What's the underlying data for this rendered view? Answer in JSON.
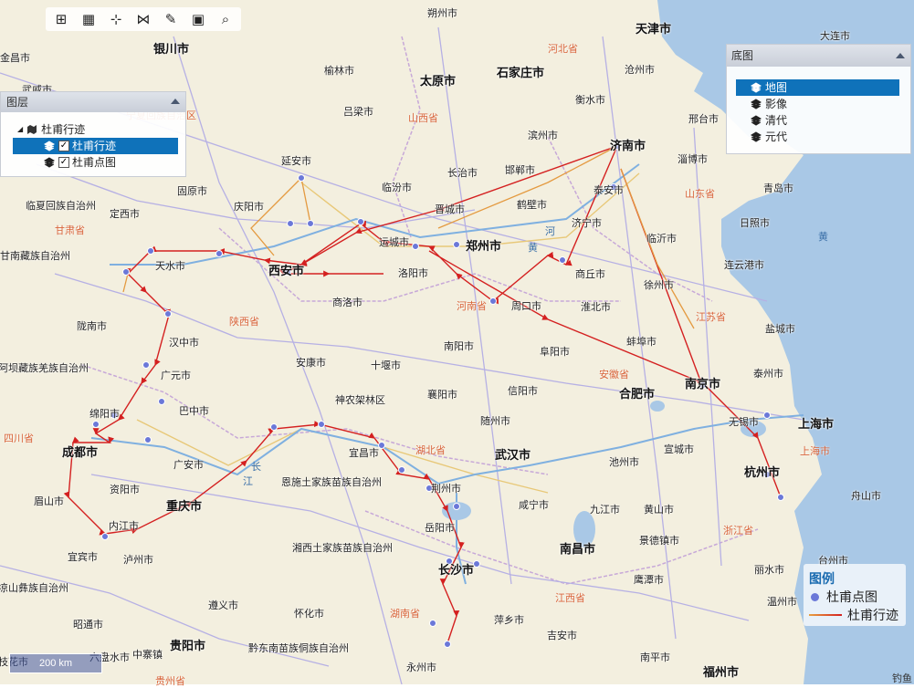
{
  "toolbar": {
    "buttons": [
      {
        "name": "zoom-in-button",
        "icon": "⊞"
      },
      {
        "name": "layers-button",
        "icon": "▦"
      },
      {
        "name": "add-point-button",
        "icon": "⊹"
      },
      {
        "name": "share-button",
        "icon": "⋈"
      },
      {
        "name": "measure-button",
        "icon": "✎"
      },
      {
        "name": "save-button",
        "icon": "▣"
      },
      {
        "name": "search-button",
        "icon": "⌕"
      }
    ]
  },
  "layer_panel": {
    "title": "图层",
    "group_label": "杜甫行迹",
    "layers": [
      {
        "label": "杜甫行迹",
        "checked": "✓"
      },
      {
        "label": "杜甫点图",
        "checked": "✓"
      }
    ]
  },
  "base_panel": {
    "title": "底图",
    "items": [
      "地图",
      "影像",
      "清代",
      "元代"
    ]
  },
  "legend": {
    "title": "图例",
    "point_label": "杜甫点图",
    "line_label": "杜甫行迹",
    "point_color": "#6b78d8",
    "line_color": "#d42020"
  },
  "scale_label": "200 km",
  "credit": "钓鱼",
  "cities": [
    {
      "label": "朔州市"
    },
    {
      "label": "天津市"
    },
    {
      "label": "大连市"
    },
    {
      "label": "金昌市"
    },
    {
      "label": "银川市"
    },
    {
      "label": "榆林市"
    },
    {
      "label": "太原市"
    },
    {
      "label": "石家庄市"
    },
    {
      "label": "沧州市"
    },
    {
      "label": "武威市"
    },
    {
      "label": "衡水市"
    },
    {
      "label": "吕梁市"
    },
    {
      "label": "邢台市"
    },
    {
      "label": "滨州市"
    },
    {
      "label": "延安市"
    },
    {
      "label": "济南市"
    },
    {
      "label": "淄博市"
    },
    {
      "label": "长治市"
    },
    {
      "label": "邯郸市"
    },
    {
      "label": "临汾市"
    },
    {
      "label": "固原市"
    },
    {
      "label": "庆阳市"
    },
    {
      "label": "泰安市"
    },
    {
      "label": "青岛市"
    },
    {
      "label": "晋城市"
    },
    {
      "label": "鹤壁市"
    },
    {
      "label": "临夏回族自治州"
    },
    {
      "label": "定西市"
    },
    {
      "label": "济宁市"
    },
    {
      "label": "日照市"
    },
    {
      "label": "临沂市"
    },
    {
      "label": "运城市"
    },
    {
      "label": "郑州市"
    },
    {
      "label": "甘南藏族自治州"
    },
    {
      "label": "天水市"
    },
    {
      "label": "西安市"
    },
    {
      "label": "洛阳市"
    },
    {
      "label": "商丘市"
    },
    {
      "label": "连云港市"
    },
    {
      "label": "徐州市"
    },
    {
      "label": "商洛市"
    },
    {
      "label": "周口市"
    },
    {
      "label": "淮北市"
    },
    {
      "label": "盐城市"
    },
    {
      "label": "陇南市"
    },
    {
      "label": "汉中市"
    },
    {
      "label": "南阳市"
    },
    {
      "label": "蚌埠市"
    },
    {
      "label": "安康市"
    },
    {
      "label": "十堰市"
    },
    {
      "label": "阜阳市"
    },
    {
      "label": "阿坝藏族羌族自治州"
    },
    {
      "label": "广元市"
    },
    {
      "label": "泰州市"
    },
    {
      "label": "南京市"
    },
    {
      "label": "合肥市"
    },
    {
      "label": "神农架林区"
    },
    {
      "label": "襄阳市"
    },
    {
      "label": "信阳市"
    },
    {
      "label": "巴中市"
    },
    {
      "label": "绵阳市"
    },
    {
      "label": "随州市"
    },
    {
      "label": "无锡市"
    },
    {
      "label": "上海市"
    },
    {
      "label": "成都市"
    },
    {
      "label": "宜昌市"
    },
    {
      "label": "武汉市"
    },
    {
      "label": "宣城市"
    },
    {
      "label": "广安市"
    },
    {
      "label": "恩施土家族苗族自治州"
    },
    {
      "label": "荆州市"
    },
    {
      "label": "池州市"
    },
    {
      "label": "杭州市"
    },
    {
      "label": "资阳市"
    },
    {
      "label": "舟山市"
    },
    {
      "label": "眉山市"
    },
    {
      "label": "重庆市"
    },
    {
      "label": "咸宁市"
    },
    {
      "label": "九江市"
    },
    {
      "label": "黄山市"
    },
    {
      "label": "内江市"
    },
    {
      "label": "岳阳市"
    },
    {
      "label": "景德镇市"
    },
    {
      "label": "宜宾市"
    },
    {
      "label": "泸州市"
    },
    {
      "label": "湘西土家族苗族自治州"
    },
    {
      "label": "南昌市"
    },
    {
      "label": "长沙市"
    },
    {
      "label": "台州市"
    },
    {
      "label": "丽水市"
    },
    {
      "label": "凉山彝族自治州"
    },
    {
      "label": "鹰潭市"
    },
    {
      "label": "温州市"
    },
    {
      "label": "遵义市"
    },
    {
      "label": "昭通市"
    },
    {
      "label": "怀化市"
    },
    {
      "label": "萍乡市"
    },
    {
      "label": "吉安市"
    },
    {
      "label": "贵阳市"
    },
    {
      "label": "六盘水市"
    },
    {
      "label": "黔东南苗族侗族自治州"
    },
    {
      "label": "中寨镇"
    },
    {
      "label": "永州市"
    },
    {
      "label": "南平市"
    },
    {
      "label": "福州市"
    },
    {
      "label": "枝花市"
    }
  ],
  "provinces": [
    "河北省",
    "山西省",
    "山东省",
    "甘肃省",
    "陕西省",
    "河南省",
    "江苏省",
    "安徽省",
    "四川省",
    "湖北省",
    "上海市",
    "浙江省",
    "江西省",
    "湖南省",
    "贵州省",
    "宁夏回族自治区"
  ],
  "water_labels": [
    "黄",
    "河",
    "长",
    "江",
    "黄"
  ]
}
